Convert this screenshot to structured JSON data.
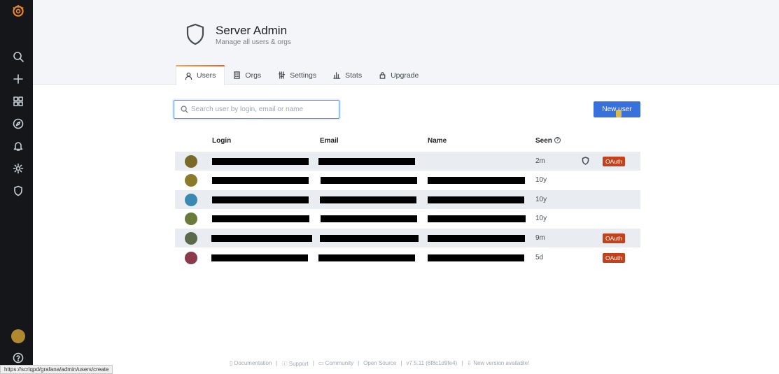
{
  "page": {
    "title": "Server Admin",
    "subtitle": "Manage all users & orgs"
  },
  "sidebar": {
    "items": [
      {
        "name": "search-icon"
      },
      {
        "name": "plus-icon"
      },
      {
        "name": "dashboards-icon"
      },
      {
        "name": "explore-icon"
      },
      {
        "name": "alerting-icon"
      },
      {
        "name": "gear-icon"
      },
      {
        "name": "shield-icon"
      }
    ]
  },
  "tabs": [
    {
      "label": "Users",
      "active": true,
      "icon": "user-icon"
    },
    {
      "label": "Orgs",
      "active": false,
      "icon": "building-icon"
    },
    {
      "label": "Settings",
      "active": false,
      "icon": "sliders-icon"
    },
    {
      "label": "Stats",
      "active": false,
      "icon": "bar-chart-icon"
    },
    {
      "label": "Upgrade",
      "active": false,
      "icon": "lock-icon"
    }
  ],
  "search": {
    "placeholder": "Search user by login, email or name",
    "value": ""
  },
  "toolbar": {
    "new_user_label": "New user"
  },
  "table": {
    "headers": {
      "login": "Login",
      "email": "Email",
      "name": "Name",
      "seen": "Seen"
    },
    "rows": [
      {
        "seen": "2m",
        "admin": true,
        "oauth": "OAuth",
        "avatar_color": "#7a6a2a"
      },
      {
        "seen": "10y",
        "admin": false,
        "oauth": "",
        "avatar_color": "#8a7a2a"
      },
      {
        "seen": "10y",
        "admin": false,
        "oauth": "",
        "avatar_color": "#3a8ab0"
      },
      {
        "seen": "10y",
        "admin": false,
        "oauth": "",
        "avatar_color": "#6a7a3a"
      },
      {
        "seen": "9m",
        "admin": false,
        "oauth": "OAuth",
        "avatar_color": "#5a6a4a"
      },
      {
        "seen": "5d",
        "admin": false,
        "oauth": "OAuth",
        "avatar_color": "#8a3a4a"
      }
    ]
  },
  "footer": {
    "documentation": "Documentation",
    "support": "Support",
    "community": "Community",
    "open_source": "Open Source",
    "version": "v7.5.11 (6f8c1d9fe4)",
    "new_version": "New version available!"
  },
  "status_url": "https://scrlqpd/grafana/admin/users/create",
  "colors": {
    "primary": "#3871dc",
    "oauth_badge": "#c4421b",
    "sidebar_bg": "#141619"
  }
}
